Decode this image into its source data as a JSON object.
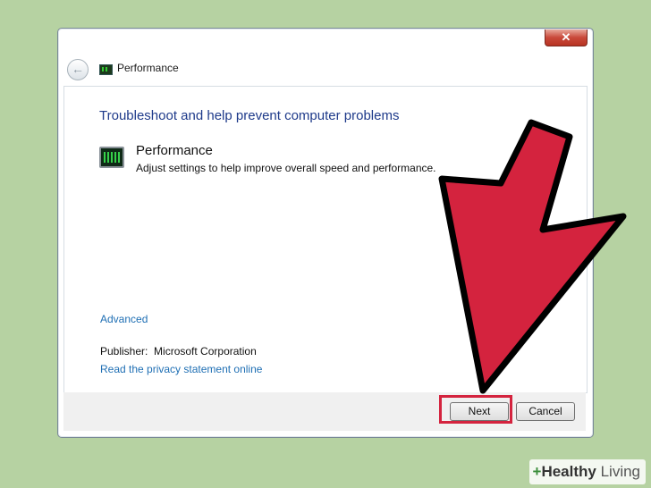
{
  "window": {
    "title": "Performance",
    "close_glyph": "✕",
    "back_glyph": "←"
  },
  "content": {
    "heading": "Troubleshoot and help prevent computer problems",
    "item": {
      "title": "Performance",
      "description": "Adjust settings to help improve overall speed and performance."
    },
    "advanced_link": "Advanced",
    "publisher_label": "Publisher:",
    "publisher_value": "Microsoft Corporation",
    "privacy_link": "Read the privacy statement online"
  },
  "footer": {
    "next_label": "Next",
    "cancel_label": "Cancel"
  },
  "annotation": {
    "arrow_color": "#d4233e",
    "highlight_color": "#d4233e"
  },
  "watermark": {
    "plus": "+",
    "part1": "Healthy",
    "part2": " Living"
  }
}
